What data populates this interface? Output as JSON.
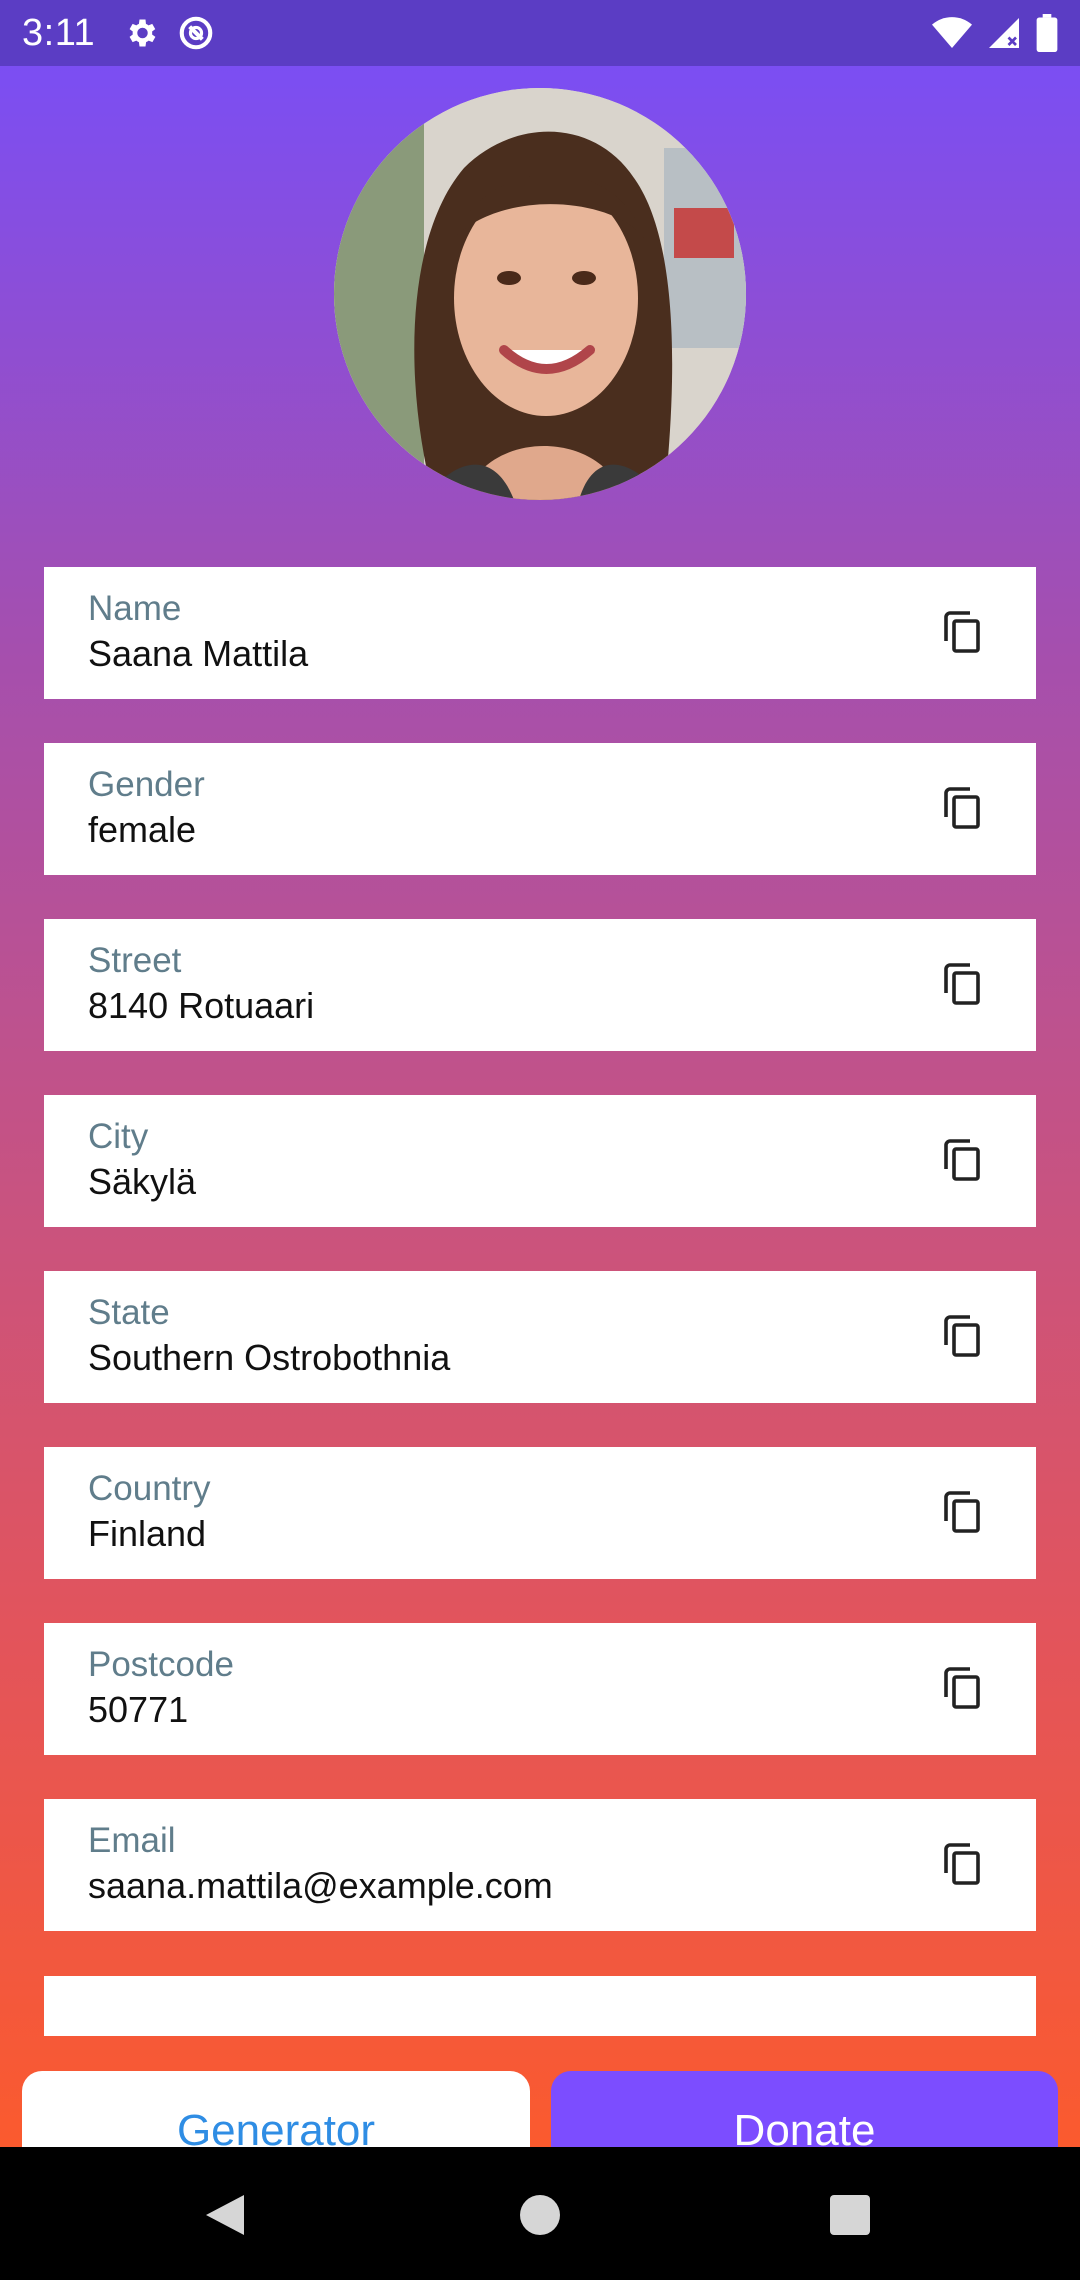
{
  "status_bar": {
    "time": "3:11",
    "icons": [
      "settings-icon",
      "sync-icon",
      "wifi-icon",
      "signal-icon",
      "battery-icon"
    ]
  },
  "profile": {
    "avatar": "profile-photo"
  },
  "fields": [
    {
      "label": "Name",
      "value": "Saana Mattila"
    },
    {
      "label": "Gender",
      "value": "female"
    },
    {
      "label": "Street",
      "value": "8140 Rotuaari"
    },
    {
      "label": "City",
      "value": "Säkylä"
    },
    {
      "label": "State",
      "value": "Southern Ostrobothnia"
    },
    {
      "label": "Country",
      "value": "Finland"
    },
    {
      "label": "Postcode",
      "value": "50771"
    },
    {
      "label": "Email",
      "value": "saana.mattila@example.com"
    }
  ],
  "actions": {
    "generator_label": "Generator",
    "donate_label": "Donate"
  },
  "colors": {
    "gradient_top": "#7b4ef3",
    "gradient_bottom": "#fb5a2e",
    "donate": "#7c4dff",
    "generator_text": "#2f8de4",
    "field_label": "#607d8b"
  },
  "navigation": {
    "icons": [
      "back-icon",
      "home-icon",
      "recents-icon"
    ]
  }
}
